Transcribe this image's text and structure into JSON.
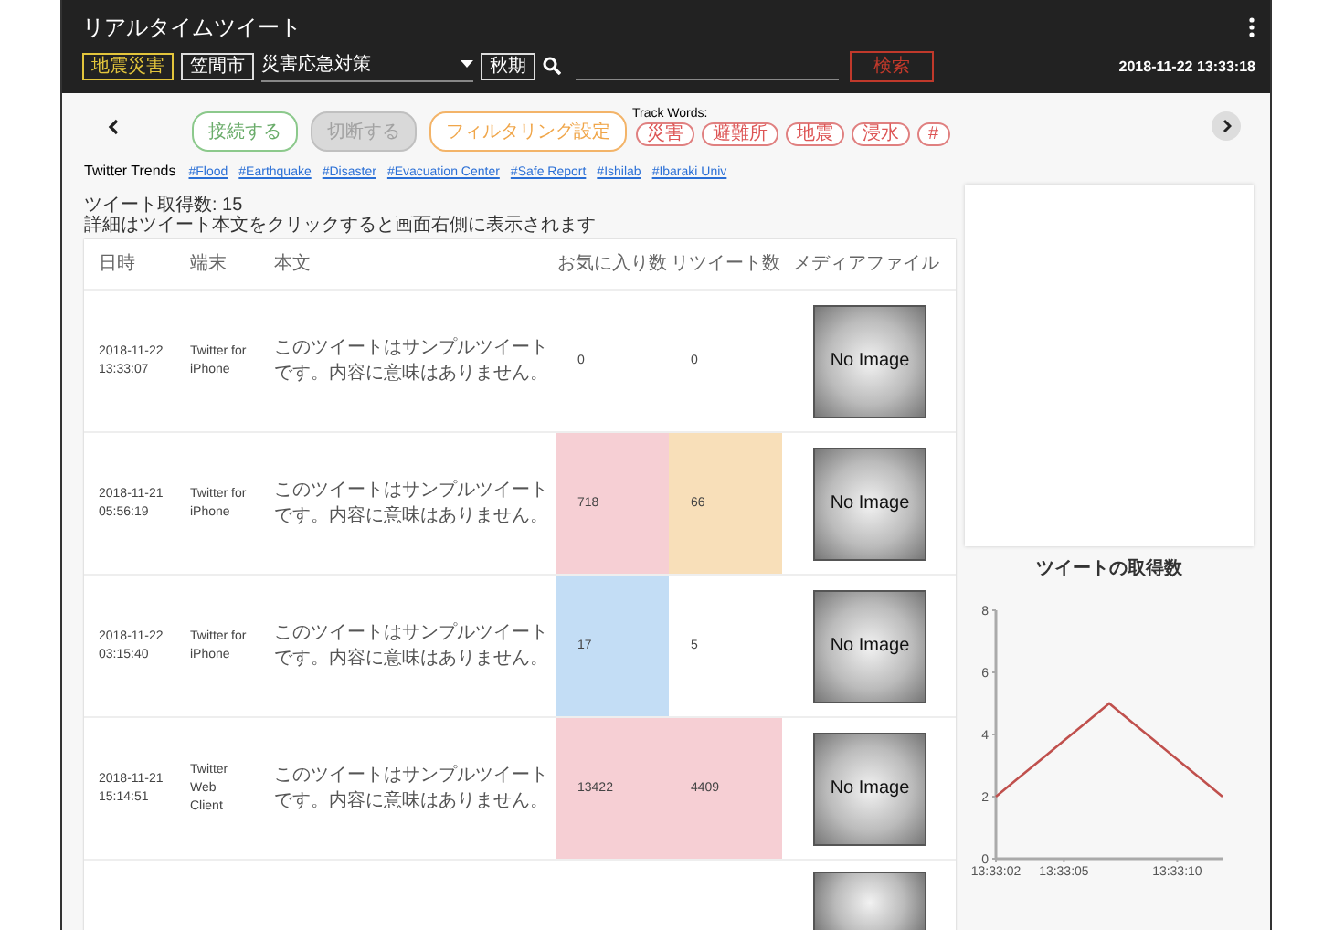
{
  "header": {
    "title": "リアルタイムツイート",
    "disaster_button": "地震災害",
    "city_button": "笠間市",
    "category_select": {
      "value": "災害応急対策"
    },
    "period_button": "秋期",
    "search_button": "検索",
    "datetime": "2018-11-22 13:33:18"
  },
  "controls": {
    "buttons": [
      {
        "label": "接続する",
        "kind": "connect",
        "disabled": false
      },
      {
        "label": "切断する",
        "kind": "disconnect",
        "disabled": true
      },
      {
        "label": "フィルタリング設定",
        "kind": "filter",
        "disabled": false
      }
    ],
    "track_words_label": "Track Words:",
    "track_words": [
      "災害",
      "避難所",
      "地震",
      "浸水",
      "#"
    ]
  },
  "trends": {
    "label": "Twitter Trends",
    "tags": [
      "#Flood",
      "#Earthquake",
      "#Disaster",
      "#Evacuation Center",
      "#Safe Report",
      "#Ishilab",
      "#Ibaraki Univ"
    ]
  },
  "tweet_count": "ツイート取得数: 15",
  "hint": "詳細はツイート本文をクリックすると画面右側に表示されます",
  "table": {
    "columns": [
      "日時",
      "端末",
      "本文",
      "お気に入り数",
      "リツイート数",
      "メディアファイル"
    ],
    "rows": [
      {
        "date": "2018-11-22\n13:33:07",
        "device": "Twitter for\niPhone",
        "body": "このツイートはサンプルツイートです。内容に意味はありません。",
        "favorites": {
          "text": "0"
        },
        "retweets": {
          "text": "0"
        },
        "media": "No Image"
      },
      {
        "date": "2018-11-21\n05:56:19",
        "device": "Twitter for\niPhone",
        "body": "このツイートはサンプルツイートです。内容に意味はありません。",
        "favorites": {
          "text": "718",
          "color": "#f6cfd4"
        },
        "retweets": {
          "text": "66",
          "color": "#f8dfb9"
        },
        "media": "No Image"
      },
      {
        "date": "2018-11-22\n03:15:40",
        "device": "Twitter for\niPhone",
        "body": "このツイートはサンプルツイートです。内容に意味はありません。",
        "favorites": {
          "text": "17",
          "color": "#c3ddf5"
        },
        "retweets": {
          "text": "5"
        },
        "media": "No Image"
      },
      {
        "date": "2018-11-21\n15:14:51",
        "device": "Twitter\nWeb\nClient",
        "body": "このツイートはサンプルツイートです。内容に意味はありません。",
        "favorites": {
          "text": "13422",
          "color": "#f6cfd4"
        },
        "retweets": {
          "text": "4409",
          "color": "#f6cfd4"
        },
        "media": "No Image"
      },
      {
        "kind": "partial"
      }
    ]
  },
  "chart": {
    "chart_data": {
      "type": "line",
      "title": "ツイートの取得数",
      "categories": [
        "13:33:02",
        null,
        null,
        "13:33:05",
        null,
        null,
        null,
        null,
        "13:33:10",
        null,
        null
      ],
      "series": [
        {
          "color": "#c0504d",
          "values": [
            2,
            2.6,
            3.2,
            3.8,
            4.4,
            5,
            4.4,
            3.8,
            3.2,
            2.6,
            2
          ]
        }
      ],
      "ylim": [
        0,
        8
      ],
      "yticks": [
        0,
        2,
        4,
        6,
        8
      ]
    }
  }
}
